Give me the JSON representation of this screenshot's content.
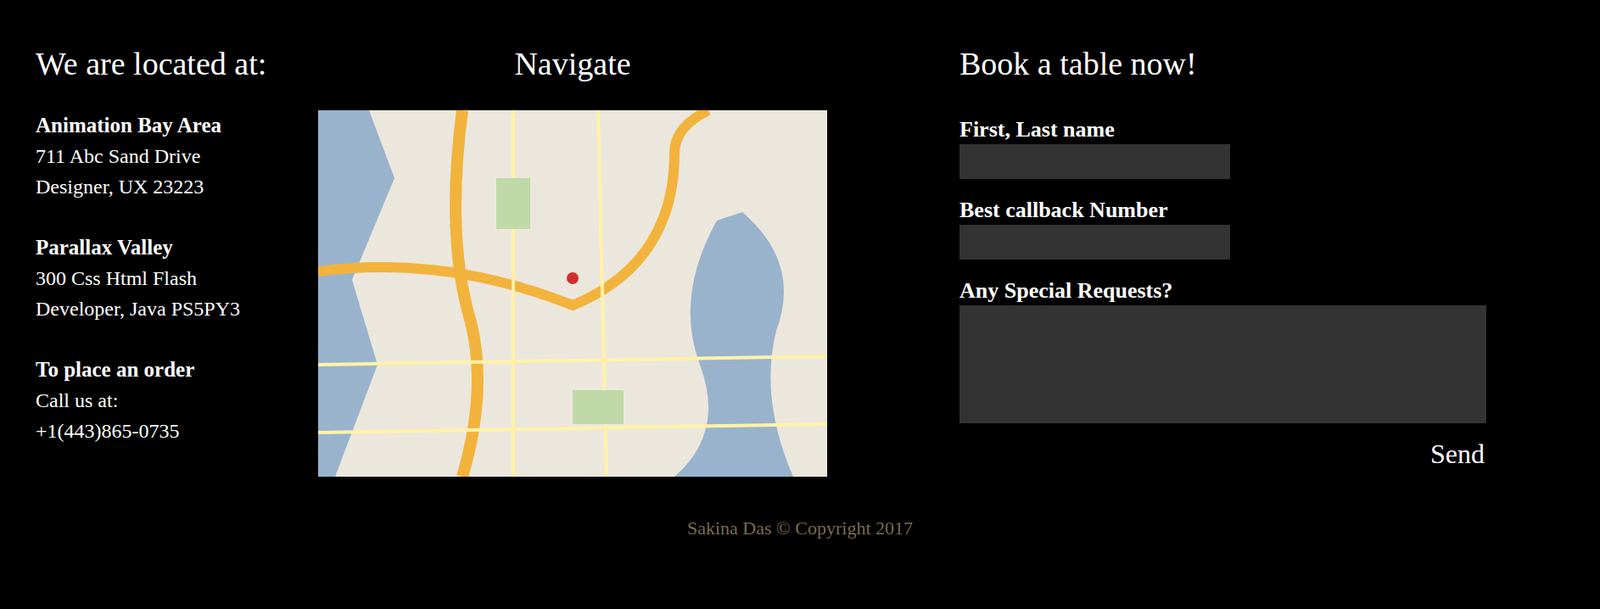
{
  "location": {
    "heading": "We are located at:",
    "addresses": [
      {
        "name": "Animation Bay Area",
        "lines": [
          "711 Abc Sand Drive",
          "Designer, UX 23223"
        ]
      },
      {
        "name": "Parallax Valley",
        "lines": [
          "300 Css Html Flash",
          "Developer, Java PS5PY3"
        ]
      }
    ],
    "order": {
      "title": "To place an order",
      "lines": [
        "Call us at:",
        "+1(443)865-0735"
      ]
    }
  },
  "navigate": {
    "heading": "Navigate"
  },
  "booking": {
    "heading": "Book a table now!",
    "fields": [
      {
        "label": "First, Last name",
        "kind": "input",
        "value": ""
      },
      {
        "label": "Best callback Number",
        "kind": "input",
        "value": ""
      },
      {
        "label": "Any Special Requests?",
        "kind": "textarea",
        "value": ""
      }
    ],
    "button": "Send"
  },
  "footer": {
    "copyright": "Sakina Das © Copyright 2017"
  }
}
